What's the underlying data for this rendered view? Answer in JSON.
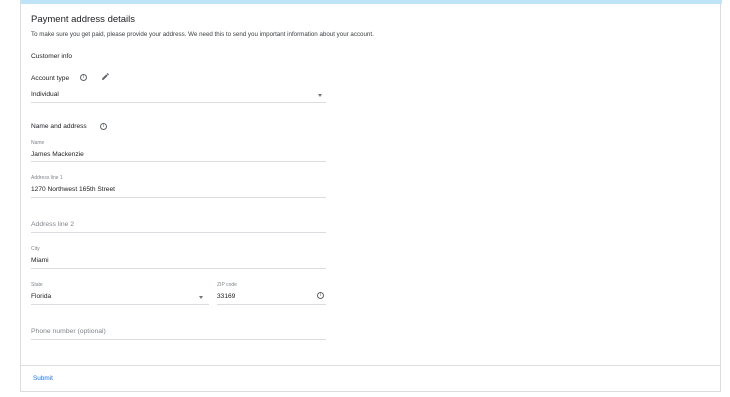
{
  "header": {
    "title": "Payment address details",
    "description": "To make sure you get paid, please provide your address. We need this to send you important information about your account."
  },
  "customer_info": {
    "heading": "Customer info",
    "account_type_label": "Account type",
    "account_type_value": "Individual"
  },
  "name_address": {
    "heading": "Name and address",
    "name_label": "Name",
    "name_value": "James Mackenzie",
    "address1_label": "Address line 1",
    "address1_value": "1270 Northwest 165th Street",
    "address2_placeholder": "Address line 2",
    "city_label": "City",
    "city_value": "Miami",
    "state_label": "State",
    "state_value": "Florida",
    "zip_label": "ZIP code",
    "zip_value": "33169",
    "phone_placeholder": "Phone number (optional)"
  },
  "footer": {
    "submit_label": "Submit"
  },
  "icons": {
    "info": "info-icon",
    "edit": "pencil-icon",
    "dropdown": "chevron-down-icon"
  },
  "colors": {
    "accent_bar": "#bfe3f7",
    "link": "#1a73e8"
  }
}
